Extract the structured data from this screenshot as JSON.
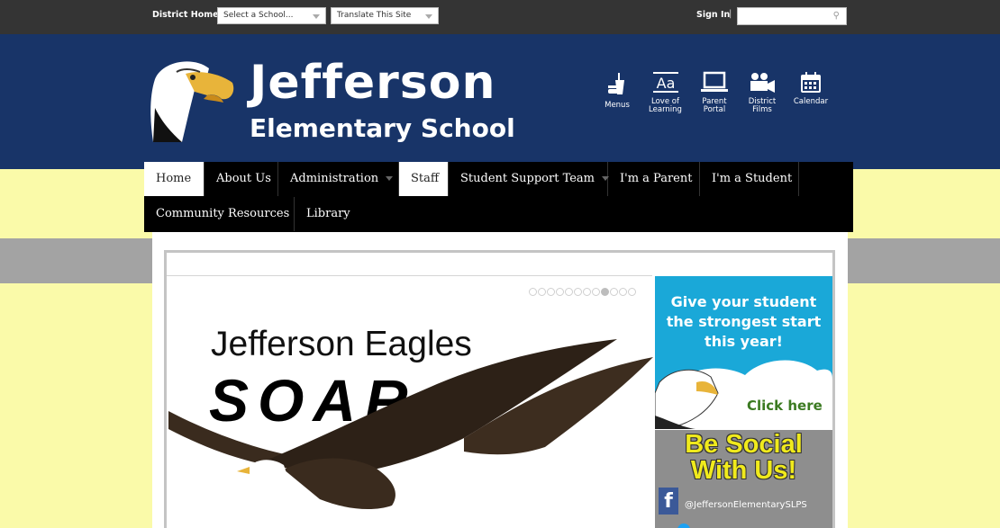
{
  "topbar": {
    "district_home": "District Home",
    "school_select": "Select a School...",
    "translate_select": "Translate This Site",
    "sign_in": "Sign In",
    "sep": "|"
  },
  "header": {
    "name_line1": "Jefferson",
    "name_line2": "Elementary School",
    "quick_links": [
      {
        "label": "Menus",
        "icon": "food-icon"
      },
      {
        "label": "Love of Learning",
        "icon": "dictionary-icon"
      },
      {
        "label": "Parent Portal",
        "icon": "laptop-icon"
      },
      {
        "label": "District Films",
        "icon": "camera-icon"
      },
      {
        "label": "Calendar",
        "icon": "calendar-icon"
      }
    ]
  },
  "nav": {
    "items": [
      {
        "label": "Home",
        "active": true
      },
      {
        "label": "About Us"
      },
      {
        "label": "Administration",
        "dropdown": true
      },
      {
        "label": "Staff",
        "active": true
      },
      {
        "label": "Student Support Team",
        "dropdown": true
      },
      {
        "label": "I'm a Parent"
      },
      {
        "label": "I'm a Student"
      },
      {
        "label": "Community Resources"
      },
      {
        "label": "Library"
      }
    ]
  },
  "slideshow": {
    "line1": "Jefferson Eagles",
    "line2": "SOAR",
    "dots_total": 12,
    "active_dot": 9
  },
  "promo": {
    "text": "Give your student the strongest start this year!",
    "cta": "Click here"
  },
  "social": {
    "title_line1": "Be Social",
    "title_line2": "With Us!",
    "fb_glyph": "f",
    "facebook_handle": "@JeffersonElementarySLPS"
  },
  "colors": {
    "header_blue": "#183468",
    "page_yellow": "#fafaa9",
    "promo_blue": "#1aa8d8"
  }
}
